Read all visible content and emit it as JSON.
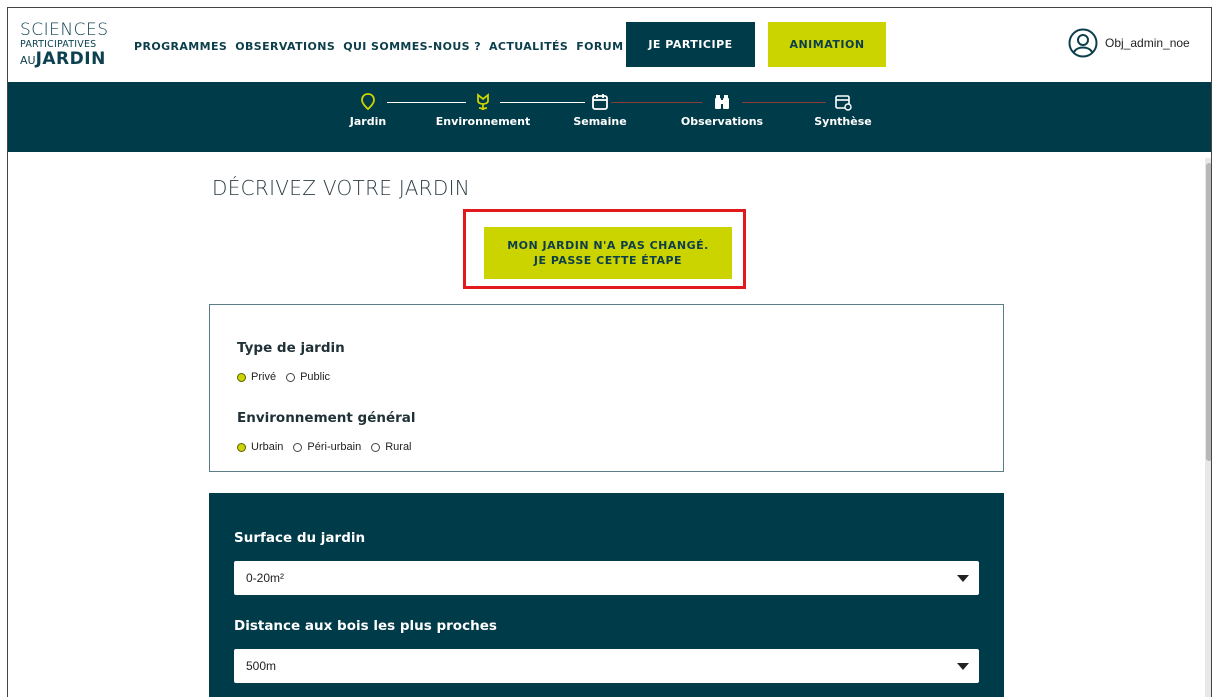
{
  "logo": {
    "line1": "SCIENCES",
    "line2": "PARTICIPATIVES",
    "line3_prefix": "AU",
    "line3_bold": "JARDIN"
  },
  "nav": [
    "PROGRAMMES",
    "OBSERVATIONS",
    "QUI SOMMES-NOUS ?",
    "ACTUALITÉS",
    "FORUM"
  ],
  "buttons": {
    "participe": "JE PARTICIPE",
    "animation": "ANIMATION"
  },
  "user": {
    "name": "Obj_admin_noe"
  },
  "steps": [
    {
      "label": "Jardin",
      "icon": "map-pin-icon"
    },
    {
      "label": "Environnement",
      "icon": "flower-icon"
    },
    {
      "label": "Semaine",
      "icon": "calendar-icon"
    },
    {
      "label": "Observations",
      "icon": "binoculars-icon"
    },
    {
      "label": "Synthèse",
      "icon": "summary-calendar-icon"
    }
  ],
  "page": {
    "title": "DÉCRIVEZ VOTRE JARDIN",
    "skip_line1": "MON JARDIN N'A PAS CHANGÉ.",
    "skip_line2": "JE PASSE CETTE ÉTAPE"
  },
  "card1": {
    "type_title": "Type de jardin",
    "type_options": [
      "Privé",
      "Public"
    ],
    "type_selected": "Privé",
    "env_title": "Environnement général",
    "env_options": [
      "Urbain",
      "Péri-urbain",
      "Rural"
    ],
    "env_selected": "Urbain"
  },
  "card2": {
    "surface_title": "Surface du jardin",
    "surface_value": "0-20m²",
    "distance_title": "Distance aux bois les plus proches",
    "distance_value": "500m"
  },
  "colors": {
    "dark": "#003b49",
    "accent": "#ccd400",
    "highlight": "#e0191c"
  }
}
